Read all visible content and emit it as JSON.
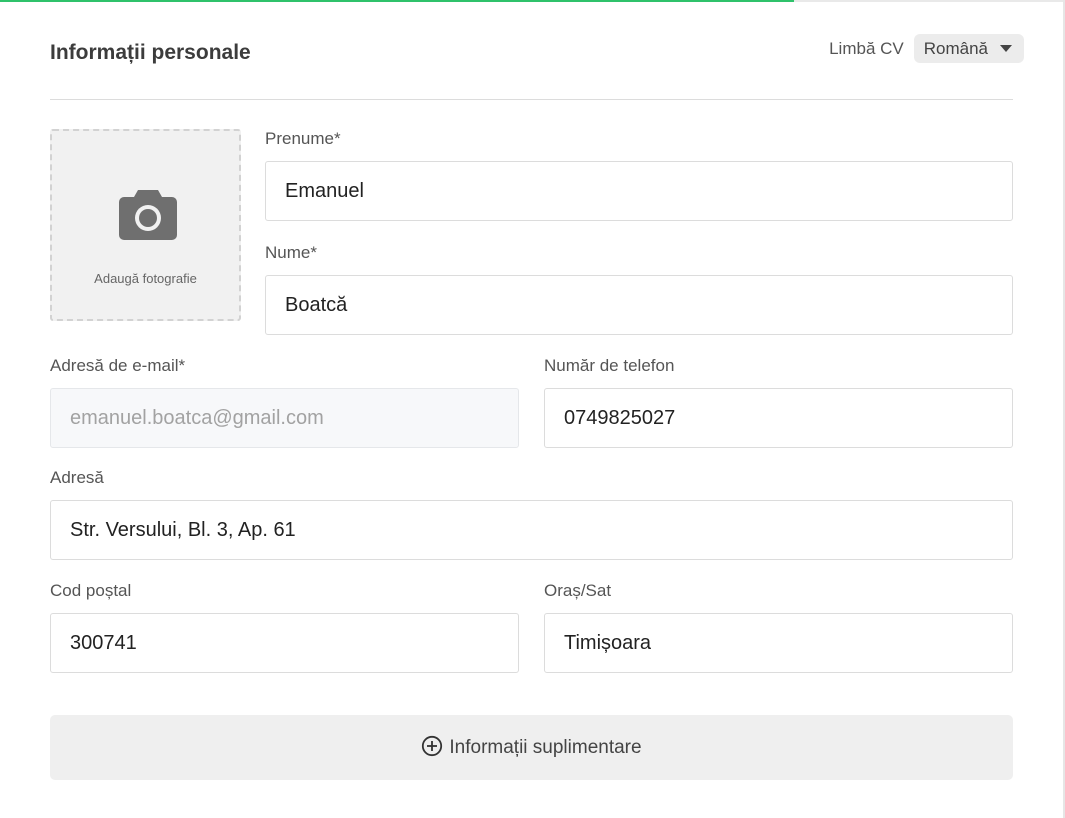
{
  "progress": {
    "fraction": 0.747,
    "color": "#2fc26b"
  },
  "header": {
    "title": "Informații personale",
    "language_label": "Limbă CV",
    "language_value": "Română"
  },
  "photo": {
    "label": "Adaugă fotografie",
    "icon": "camera-icon"
  },
  "fields": {
    "first_name": {
      "label": "Prenume*",
      "value": "Emanuel"
    },
    "last_name": {
      "label": "Nume*",
      "value": "Boatcă"
    },
    "email": {
      "label": "Adresă de e-mail*",
      "value": "emanuel.boatca@gmail.com"
    },
    "phone": {
      "label": "Număr de telefon",
      "value": "0749825027"
    },
    "address": {
      "label": "Adresă",
      "value": "Str. Versului, Bl. 3, Ap. 61"
    },
    "postal_code": {
      "label": "Cod poștal",
      "value": "300741"
    },
    "city": {
      "label": "Oraș/Sat",
      "value": "Timișoara"
    }
  },
  "more_button": {
    "label": "Informații suplimentare",
    "icon": "plus-circle-icon"
  }
}
